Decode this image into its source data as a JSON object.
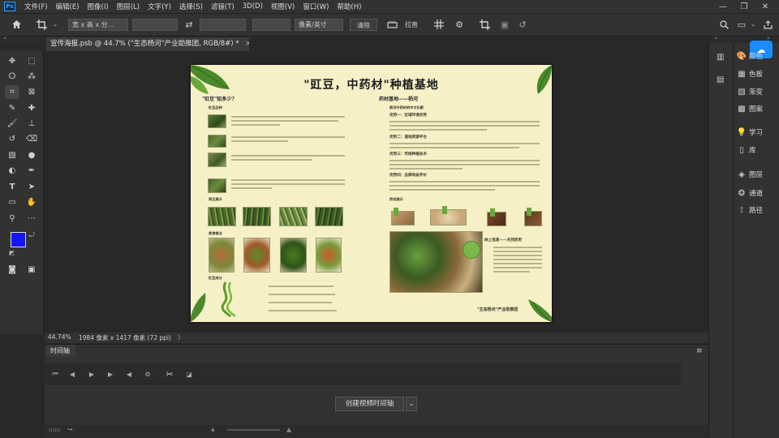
{
  "menubar": {
    "logo": "Ps",
    "items": [
      "文件(F)",
      "编辑(E)",
      "图像(I)",
      "图层(L)",
      "文字(Y)",
      "选择(S)",
      "滤镜(T)",
      "3D(D)",
      "视图(V)",
      "窗口(W)",
      "帮助(H)"
    ],
    "icons": [
      "minimize-icon",
      "restore-icon",
      "close-icon"
    ]
  },
  "options_bar": {
    "ratio_label": "宽 x 高 x 分...",
    "units_label": "像素/英寸",
    "clear_label": "清除",
    "straighten_label": "拉直"
  },
  "document": {
    "tab_title": "宣传海报.psb @ 44.7% (\"生态杨河\"产业助推团, RGB/8#) *",
    "close_glyph": "×"
  },
  "status": {
    "zoom": "44.74%",
    "size_info": "1984 像素 x 1417 像素 (72 ppi)",
    "more_glyph": "〉"
  },
  "poster": {
    "title": "\"豇豆，中药材\"种植基地",
    "left_heading": "\"豇豆\"知多少?",
    "left_sub1": "豇豆品种",
    "left_sub2": "再生展示",
    "left_sub3": "美食做法",
    "left_sub4": "豇豆成分",
    "right_heading": "药材基地——杨河",
    "right_sub1": "杨河中药材的中文化薪",
    "right_sub2": "优势一：区域环境优势",
    "right_sub3": "优势二：道地资源平台",
    "right_sub4": "优势三：传统种植技术",
    "right_sub5": "优势四：品牌效益评价",
    "right_sub6": "药材展示",
    "right_sub7": "树上信息——天然药用",
    "footer": "\"生态杨河\"产业助推团"
  },
  "timeline": {
    "tab_label": "时间轴",
    "create_label": "创建视频时间轴",
    "menu_glyph": "≡"
  },
  "dock": {
    "items": [
      {
        "label": "颜色",
        "icon": "color-icon"
      },
      {
        "label": "色板",
        "icon": "swatches-icon"
      },
      {
        "label": "渐变",
        "icon": "gradient-icon"
      },
      {
        "label": "图案",
        "icon": "pattern-icon"
      },
      {
        "label": "学习",
        "icon": "bulb-icon"
      },
      {
        "label": "库",
        "icon": "library-icon"
      },
      {
        "label": "图层",
        "icon": "layers-icon"
      },
      {
        "label": "通道",
        "icon": "channels-icon"
      },
      {
        "label": "路径",
        "icon": "paths-icon"
      }
    ]
  },
  "colors": {
    "foreground": "#1414ff",
    "background": "#1414ff",
    "accent": "#31a8ff",
    "poster_bg": "#f5f0c6"
  }
}
